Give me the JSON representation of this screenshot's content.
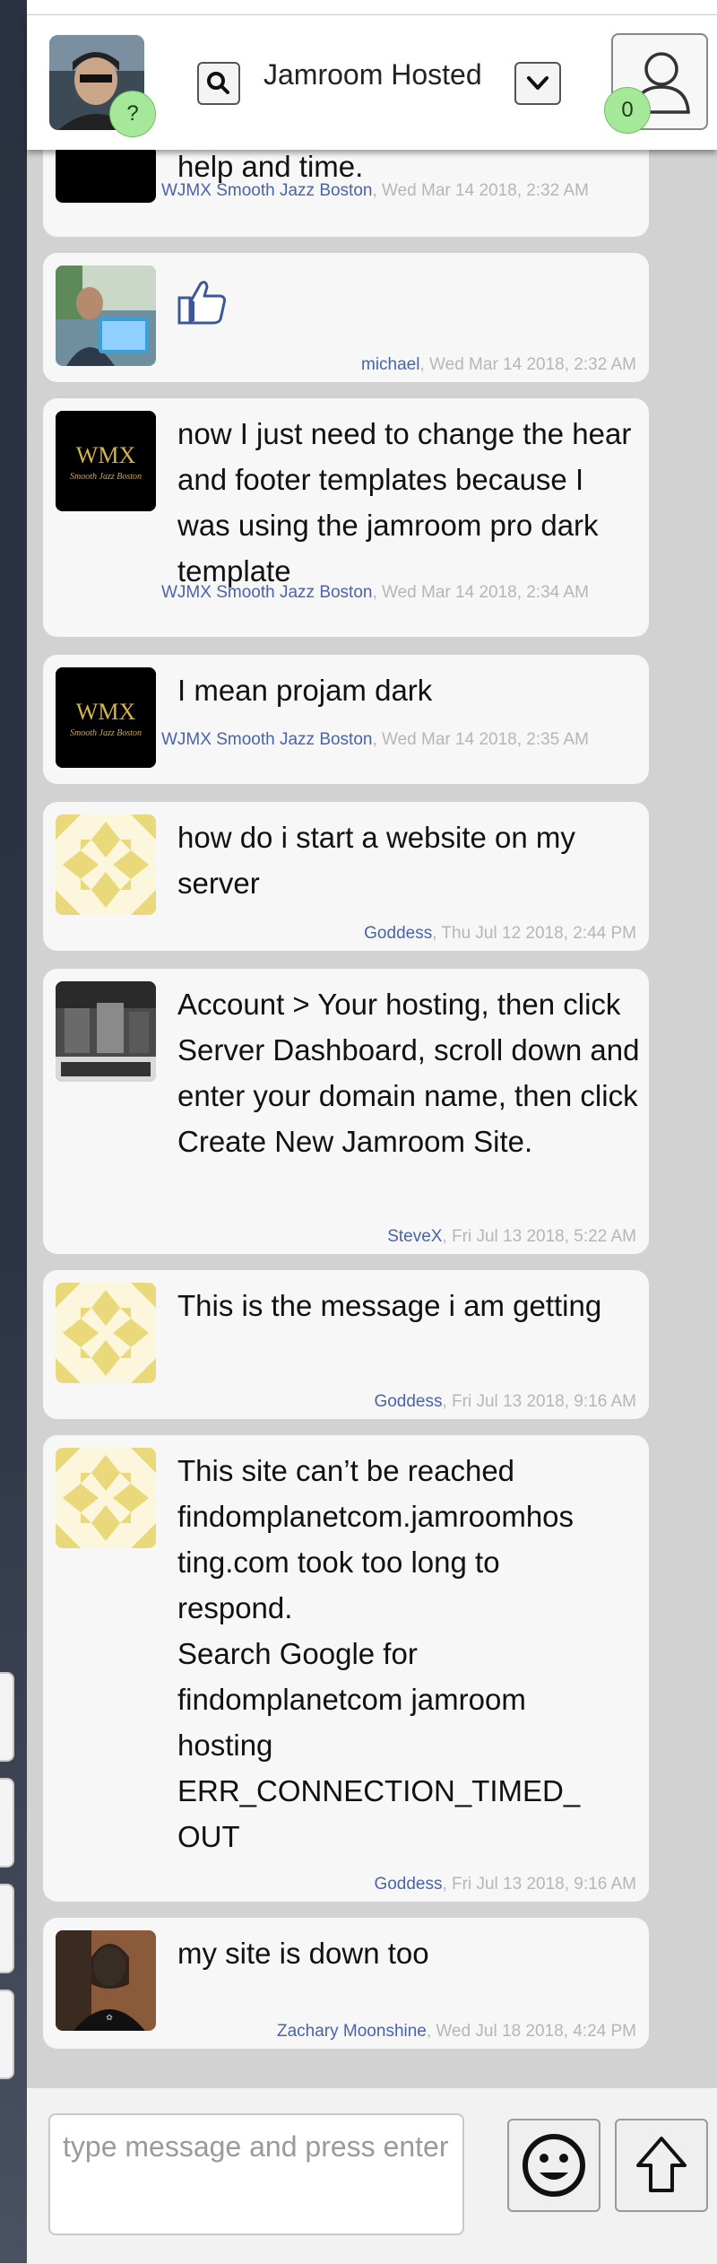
{
  "header": {
    "room_title": "Jamroom Hosted",
    "avatar_badge": "?",
    "user_badge": "0"
  },
  "messages": [
    {
      "text": "help and time.",
      "author": "WJMX Smooth Jazz Boston",
      "time": ", Wed Mar 14 2018, 2:32 AM"
    },
    {
      "text": "",
      "author": "michael",
      "time": ", Wed Mar 14 2018, 2:32 AM"
    },
    {
      "text": "now I just need to change the hear and footer templates because I was using the jamroom pro dark template",
      "author": "WJMX Smooth Jazz Boston",
      "time": ", Wed Mar 14 2018, 2:34 AM"
    },
    {
      "text": "I mean projam dark",
      "author": "WJMX Smooth Jazz Boston",
      "time": ", Wed Mar 14 2018, 2:35 AM"
    },
    {
      "text": "how do i start a website on my server",
      "author": "Goddess",
      "time": ", Thu Jul 12 2018, 2:44 PM"
    },
    {
      "text": "Account > Your hosting, then click Server Dashboard, scroll down and enter your domain name, then click Create New Jamroom Site.",
      "author": "SteveX",
      "time": ", Fri Jul 13 2018, 5:22 AM"
    },
    {
      "text": "This is the message i am getting",
      "author": "Goddess",
      "time": ", Fri Jul 13 2018, 9:16 AM"
    },
    {
      "line1": "This site can’t be reached",
      "line2": "findomplanetcom.jamroomhos",
      "line3": "ting.com took too long to",
      "line4": "respond.",
      "line5": "Search Google for",
      "line6": "findomplanetcom jamroom",
      "line7": "hosting",
      "line8": "ERR_CONNECTION_TIMED_",
      "line9": "OUT",
      "author": "Goddess",
      "time": ", Fri Jul 13 2018, 9:16 AM"
    },
    {
      "text": "my site is down too",
      "author": "Zachary Moonshine",
      "time": ", Wed Jul 18 2018, 4:24 PM"
    }
  ],
  "avatars": {
    "wjmx_logo": "WMX",
    "wjmx_tagline": "Smooth Jazz Boston"
  },
  "composer": {
    "placeholder": "type message and press enter"
  },
  "icons": {
    "search": "search-icon",
    "dropdown": "chevron-down-icon",
    "user": "user-icon",
    "like": "thumbs-up-icon",
    "emoji": "smiley-icon",
    "send": "arrow-up-icon"
  },
  "colors": {
    "author_link": "#4a64a8",
    "badge_green": "#a6e89a",
    "goddess_pattern": "#e9d97a"
  }
}
